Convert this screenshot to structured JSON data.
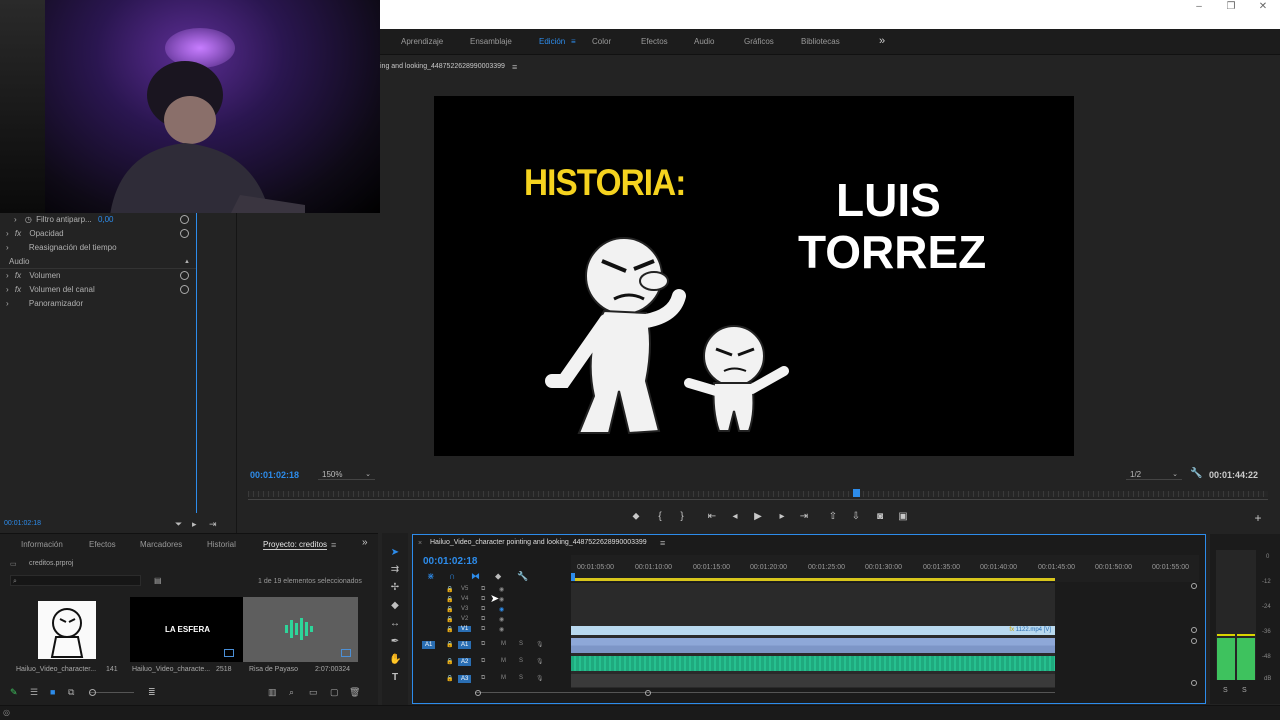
{
  "window": {
    "controls": [
      "–",
      "❐",
      "✕"
    ]
  },
  "workspaces": [
    "Aprendizaje",
    "Ensamblaje",
    "Edición",
    "Color",
    "Efectos",
    "Audio",
    "Gráficos",
    "Bibliotecas"
  ],
  "workspace_active": "Edición",
  "workspace_overflow": "»",
  "program": {
    "sequence_name": "ing and looking_4487522628990003399",
    "timecode_current": "00:01:02:18",
    "zoom": "150%",
    "resolution": "1/2",
    "timecode_total": "00:01:44:22",
    "frame_text": {
      "title": "HISTORIA:",
      "name_line1": "LUIS",
      "name_line2": "TORREZ"
    }
  },
  "effect_controls": {
    "rows": [
      {
        "label": "Filtro antiparp...",
        "value": "0,00"
      },
      {
        "label": "Opacidad"
      },
      {
        "label": "Reasignación del tiempo"
      },
      {
        "label": "Audio",
        "section": true
      },
      {
        "label": "Volumen"
      },
      {
        "label": "Volumen del canal"
      },
      {
        "label": "Panoramizador"
      }
    ],
    "timecode": "00:01:02:18"
  },
  "project": {
    "tabs": [
      "Información",
      "Efectos",
      "Marcadores",
      "Historial",
      "Proyecto: creditos"
    ],
    "active_tab": "Proyecto: creditos",
    "file": "creditos.prproj",
    "selection_info": "1 de 19 elementos seleccionados",
    "items": [
      {
        "name": "Hailuo_Video_character...",
        "duration": "141"
      },
      {
        "name": "Hailuo_Video_characte...",
        "duration": "2518",
        "thumb_text": "LA ESFERA"
      },
      {
        "name": "Risa de Payaso",
        "duration": "2:07:00324"
      }
    ]
  },
  "timeline": {
    "sequence_name": "Hailuo_Video_character pointing and looking_4487522628990003399",
    "timecode": "00:01:02:18",
    "ruler": [
      "00:01:05:00",
      "00:01:10:00",
      "00:01:15:00",
      "00:01:20:00",
      "00:01:25:00",
      "00:01:30:00",
      "00:01:35:00",
      "00:01:40:00",
      "00:01:45:00",
      "00:01:50:00",
      "00:01:55:00"
    ],
    "video_tracks": [
      "V5",
      "V4",
      "V3",
      "V2",
      "V1"
    ],
    "audio_tracks": [
      "A1",
      "A2",
      "A3"
    ],
    "source_patch": "A1",
    "clip_label": "1122.mp4 [V]",
    "mute_label": "M",
    "solo_label": "S"
  },
  "meters": {
    "scale": [
      "0",
      "-12",
      "-24",
      "-36",
      "-48",
      "dB"
    ],
    "solo_labels": [
      "S",
      "S"
    ]
  },
  "colors": {
    "accent": "#2d8ceb",
    "title_yellow": "#f5d31f",
    "video_clip": "#b9d9ef",
    "audio_clip": "#1faa7e",
    "meter_green": "#3ec25e"
  }
}
